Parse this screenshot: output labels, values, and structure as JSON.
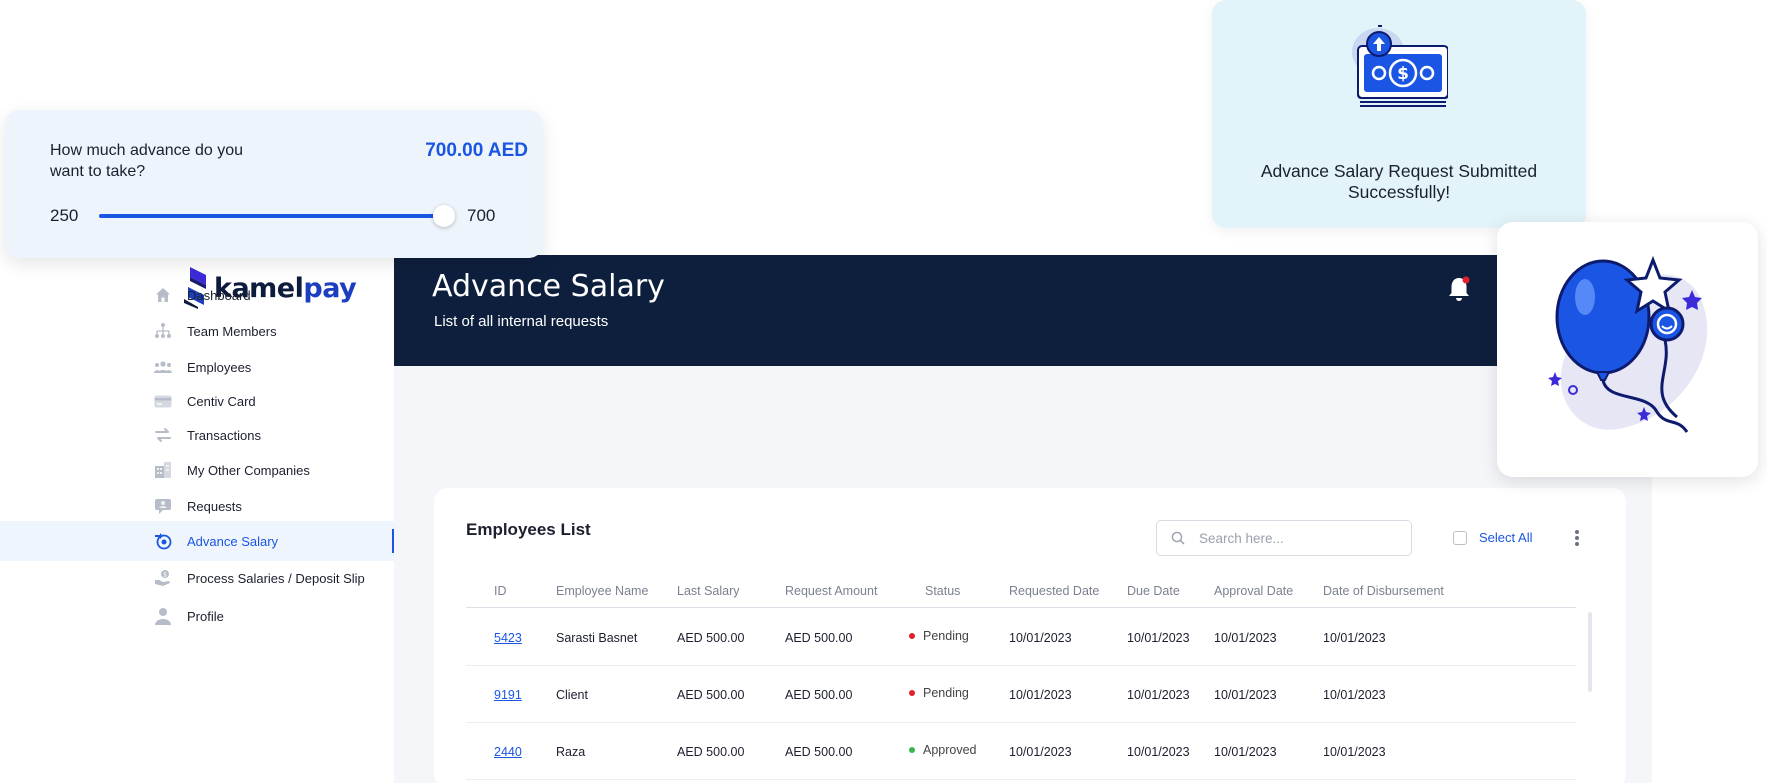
{
  "app": {
    "logo_text_primary": "kamel",
    "logo_text_accent": "pay",
    "brand_color": "#1a55e3",
    "header_color": "#0e1f3d"
  },
  "sidebar": {
    "items": [
      {
        "label": "Dashboard",
        "icon": "home-icon",
        "active": false
      },
      {
        "label": "Team Members",
        "icon": "org-chart-icon",
        "active": false
      },
      {
        "label": "Employees",
        "icon": "people-icon",
        "active": false
      },
      {
        "label": "Centiv Card",
        "icon": "card-icon",
        "active": false
      },
      {
        "label": "Transactions",
        "icon": "transfer-arrows-icon",
        "active": false
      },
      {
        "label": "My Other Companies",
        "icon": "building-icon",
        "active": false
      },
      {
        "label": "Requests",
        "icon": "request-icon",
        "active": false
      },
      {
        "label": "Advance Salary",
        "icon": "advance-salary-icon",
        "active": true
      },
      {
        "label": "Process Salaries / Deposit Slip",
        "icon": "process-salary-icon",
        "active": false
      },
      {
        "label": "Profile",
        "icon": "user-icon",
        "active": false
      }
    ]
  },
  "header": {
    "title": "Advance Salary",
    "subtitle": "List of all internal requests",
    "bell_icon": "bell-icon",
    "has_notification": true
  },
  "employees": {
    "title": "Employees List",
    "search_placeholder": "Search here...",
    "select_all_label": "Select All",
    "columns": [
      "ID",
      "Employee Name",
      "Last Salary",
      "Request Amount",
      "Status",
      "Requested Date",
      "Due Date",
      "Approval Date",
      "Date of Disbursement"
    ],
    "rows": [
      {
        "id": "5423",
        "name": "Sarasti Basnet",
        "last_salary": "AED 500.00",
        "request_amount": "AED 500.00",
        "status": "Pending",
        "status_color": "#e5202e",
        "requested_date": "10/01/2023",
        "due_date": "10/01/2023",
        "approval_date": "10/01/2023",
        "disbursement_date": "10/01/2023"
      },
      {
        "id": "9191",
        "name": "Client",
        "last_salary": "AED 500.00",
        "request_amount": "AED 500.00",
        "status": "Pending",
        "status_color": "#e5202e",
        "requested_date": "10/01/2023",
        "due_date": "10/01/2023",
        "approval_date": "10/01/2023",
        "disbursement_date": "10/01/2023"
      },
      {
        "id": "2440",
        "name": "Raza",
        "last_salary": "AED 500.00",
        "request_amount": "AED 500.00",
        "status": "Approved",
        "status_color": "#3cb54a",
        "requested_date": "10/01/2023",
        "due_date": "10/01/2023",
        "approval_date": "10/01/2023",
        "disbursement_date": "10/01/2023"
      }
    ]
  },
  "advance_slider": {
    "question": "How much advance do you want to take?",
    "amount_label": "700.00 AED",
    "min_label": "250",
    "max_label": "700",
    "min": 250,
    "max": 700,
    "value": 700
  },
  "success_popup": {
    "message": "Advance Salary Request Submitted Successfully!",
    "icon": "money-upload-icon"
  },
  "celebration_card": {
    "icon": "balloon-icon"
  }
}
